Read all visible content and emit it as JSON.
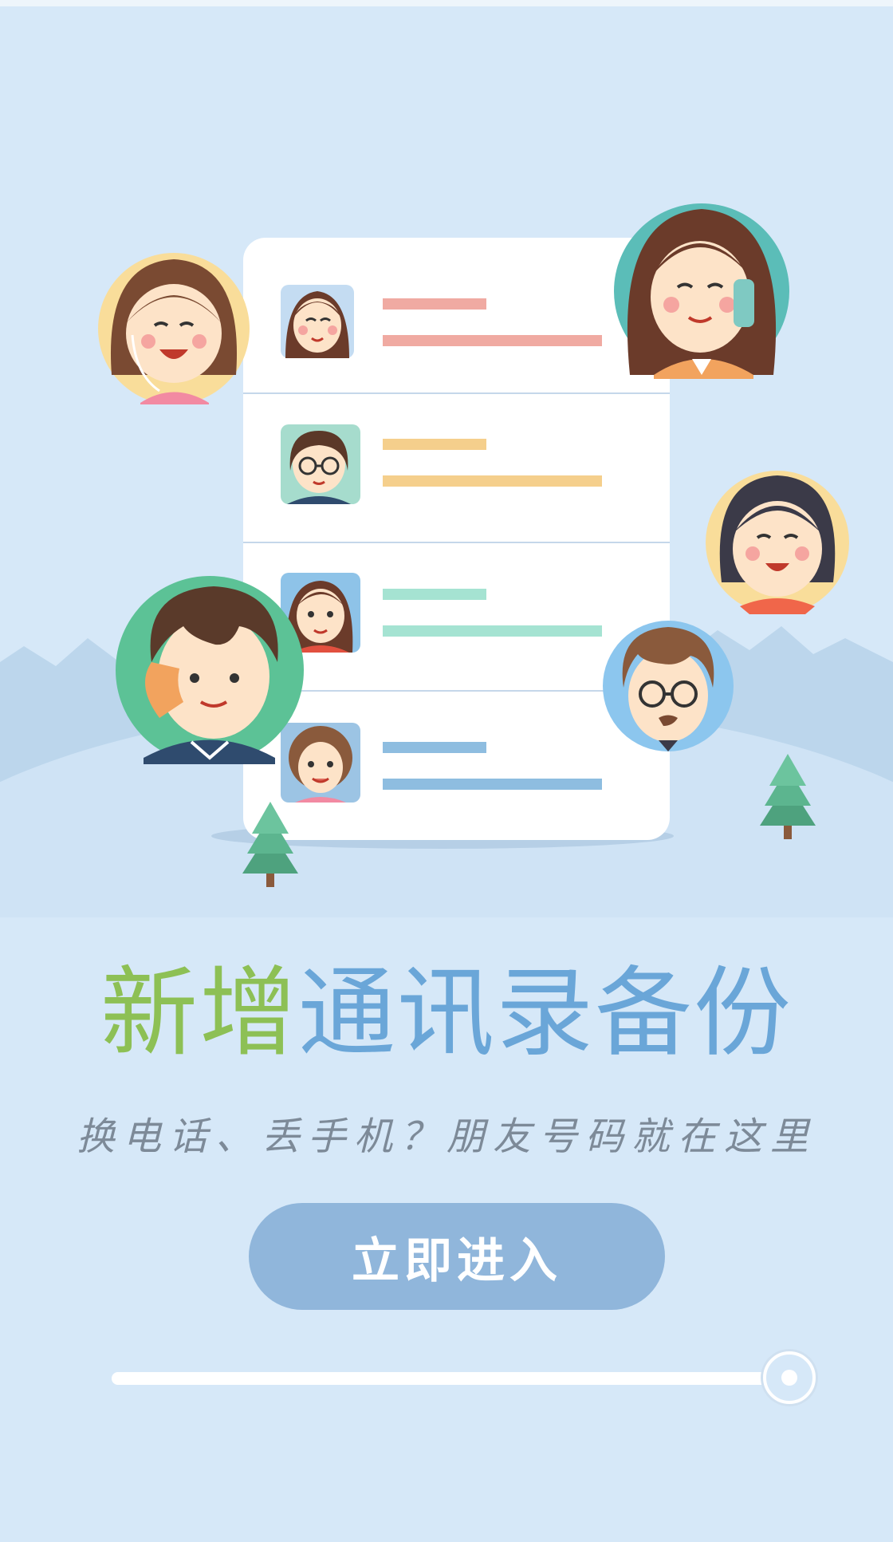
{
  "headline": {
    "accent": "新增",
    "rest": "通讯录备份"
  },
  "subtitle": "换电话、丢手机？朋友号码就在这里",
  "enter_button": {
    "label": "立即进入"
  },
  "progress": {
    "value": 1.0
  },
  "colors": {
    "background": "#d6e8f8",
    "accent_green": "#8dc055",
    "title_blue": "#6aa6d8",
    "button": "#90b6db"
  },
  "contact_list": {
    "rows": [
      {
        "avatar": "woman-brown-hair-avatar",
        "line_color": "#f0aaa2"
      },
      {
        "avatar": "girl-glasses-avatar",
        "line_color": "#f5cf8c"
      },
      {
        "avatar": "girl-red-top-avatar",
        "line_color": "#a5e3d2"
      },
      {
        "avatar": "woman-curly-hair-avatar",
        "line_color": "#8ebde0"
      }
    ]
  },
  "floating_avatars": [
    "woman-earphones-icon",
    "woman-phone-call-icon",
    "woman-dark-hair-icon",
    "man-phone-call-icon",
    "man-glasses-icon"
  ]
}
